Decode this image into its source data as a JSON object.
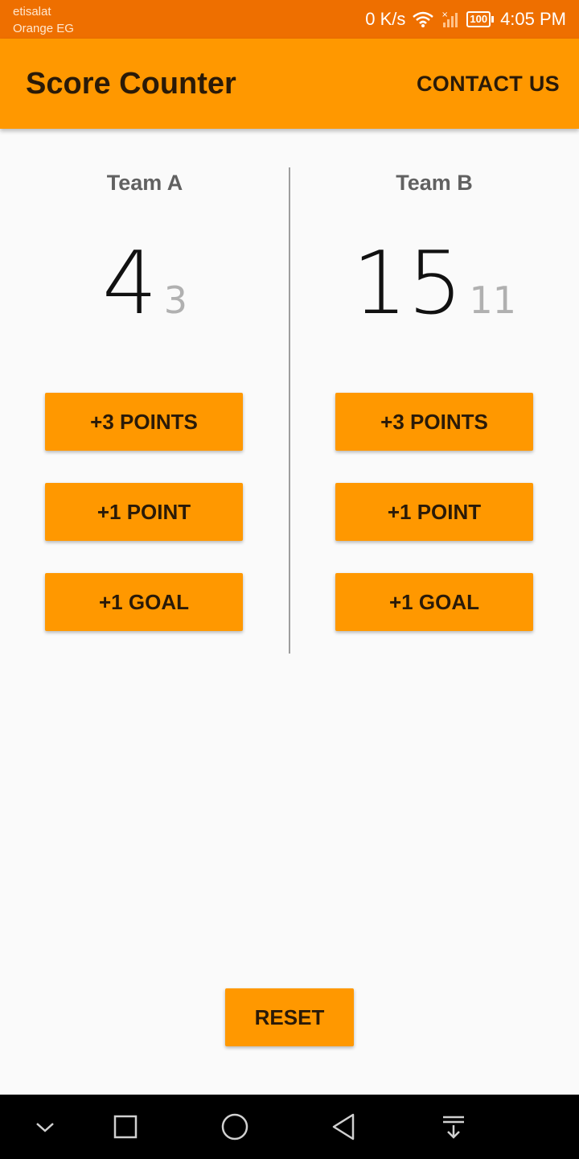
{
  "status_bar": {
    "carrier_line1": "etisalat",
    "carrier_line2": "Orange EG",
    "net_speed": "0 K/s",
    "battery": "100",
    "time": "4:05 PM"
  },
  "app_bar": {
    "title": "Score Counter",
    "action_label": "CONTACT US",
    "color": "#ff9800"
  },
  "team_a": {
    "name": "Team A",
    "score": "4",
    "secondary": "3",
    "buttons": {
      "three_points": "+3 POINTS",
      "one_point": "+1 POINT",
      "one_goal": "+1 GOAL"
    }
  },
  "team_b": {
    "name": "Team B",
    "score": "15",
    "secondary": "11",
    "buttons": {
      "three_points": "+3 POINTS",
      "one_point": "+1 POINT",
      "one_goal": "+1 GOAL"
    }
  },
  "reset_label": "RESET",
  "nav_bar": {
    "icons": [
      "chevron-down-icon",
      "recents-icon",
      "home-icon",
      "back-icon",
      "notification-pull-icon"
    ]
  }
}
